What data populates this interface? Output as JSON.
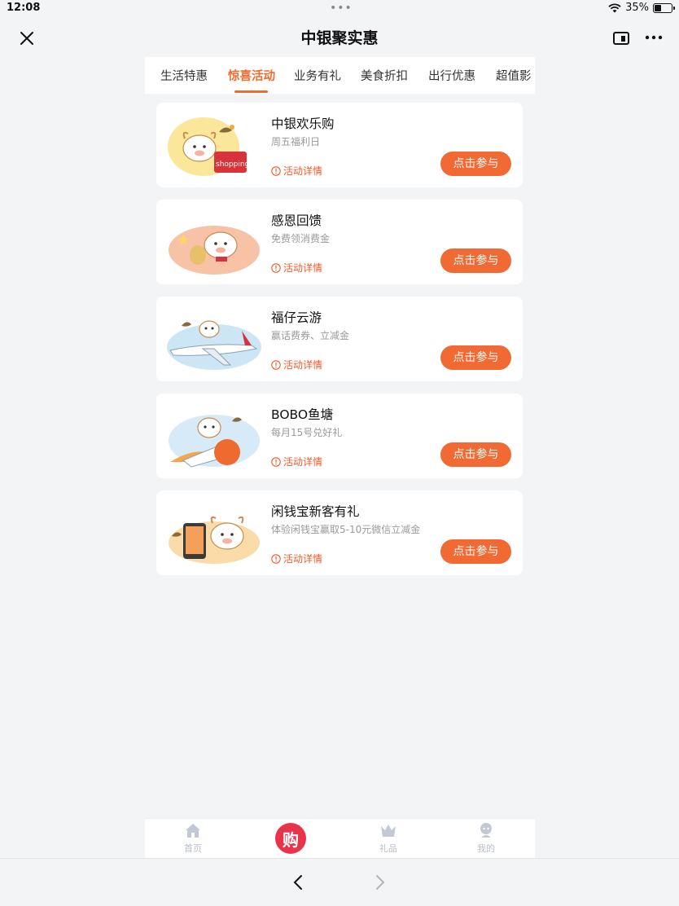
{
  "status": {
    "time": "12:08",
    "battery": "35%",
    "battery_level": 0.35
  },
  "navbar": {
    "title": "中银聚实惠"
  },
  "tabs": [
    {
      "label": "生活特惠"
    },
    {
      "label": "惊喜活动",
      "active": true
    },
    {
      "label": "业务有礼"
    },
    {
      "label": "美食折扣"
    },
    {
      "label": "出行优惠"
    },
    {
      "label": "超值影"
    }
  ],
  "cards": [
    {
      "title": "中银欢乐购",
      "subtitle": "周五福利日",
      "detail": "活动详情",
      "button": "点击参与",
      "image_text": "shopping"
    },
    {
      "title": "感恩回馈",
      "subtitle": "免费领消费金",
      "detail": "活动详情",
      "button": "点击参与"
    },
    {
      "title": "福仔云游",
      "subtitle": "赢话费券、立减金",
      "detail": "活动详情",
      "button": "点击参与"
    },
    {
      "title": "BOBO鱼塘",
      "subtitle": "每月15号兑好礼",
      "detail": "活动详情",
      "button": "点击参与"
    },
    {
      "title": "闲钱宝新客有礼",
      "subtitle": "体验闲钱宝赢取5-10元微信立减金",
      "detail": "活动详情",
      "button": "点击参与"
    }
  ],
  "tabbar": {
    "home": "首页",
    "center_glyph": "购",
    "gifts": "礼品",
    "mine": "我的"
  },
  "colors": {
    "accent": "#ef6a2e",
    "button": "#f26a33",
    "center": "#e8344a"
  }
}
